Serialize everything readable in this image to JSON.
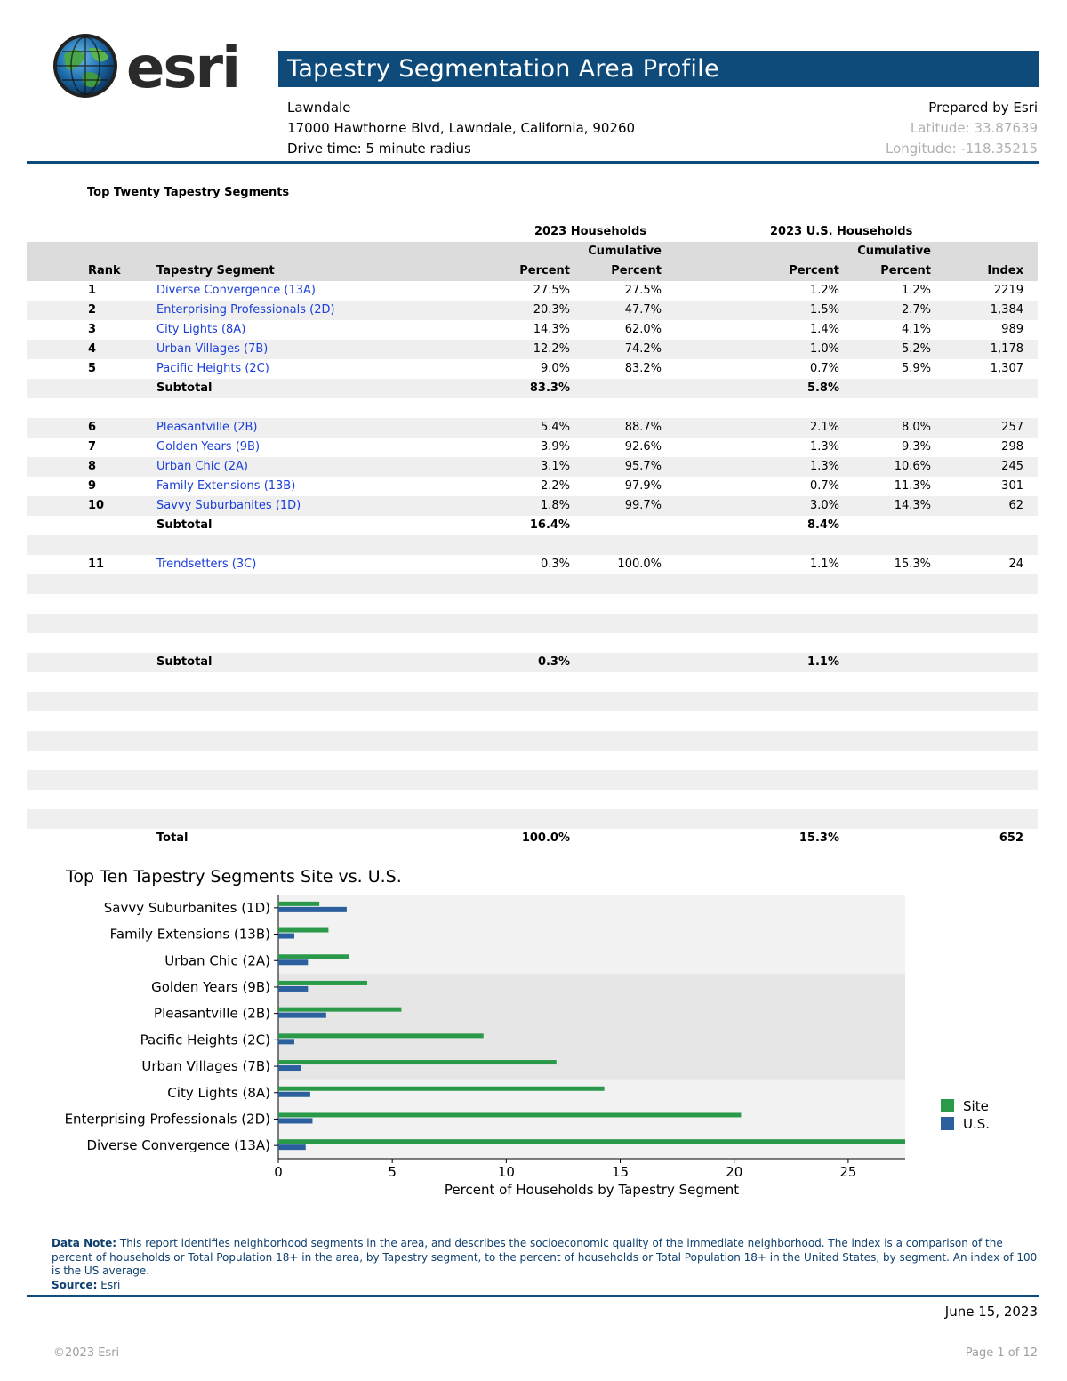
{
  "report": {
    "title": "Tapestry Segmentation Area Profile",
    "area_name": "Lawndale",
    "address": "17000 Hawthorne Blvd, Lawndale, California, 90260",
    "drive_time": "Drive time: 5 minute radius",
    "prepared_by": "Prepared by Esri",
    "latitude": "Latitude: 33.87639",
    "longitude": "Longitude: -118.35215",
    "logo_text": "esri"
  },
  "colors": {
    "brand_blue": "#0e4b7a",
    "link_blue": "#1a3ed9",
    "site_green": "#2a9a4a",
    "us_blue": "#2b5f9e"
  },
  "table": {
    "section_title": "Top Twenty Tapestry Segments",
    "group_headers": {
      "households": "2023 Households",
      "us_households": "2023 U.S. Households"
    },
    "headers": {
      "cumulative": "Cumulative",
      "rank": "Rank",
      "segment": "Tapestry Segment",
      "percent": "Percent",
      "cum_percent": "Percent",
      "us_percent": "Percent",
      "us_cum_percent": "Percent",
      "index": "Index"
    },
    "group1": [
      {
        "rank": "1",
        "segment": "Diverse Convergence (13A)",
        "pct": "27.5%",
        "cum": "27.5%",
        "us": "1.2%",
        "uscum": "1.2%",
        "idx": "2219"
      },
      {
        "rank": "2",
        "segment": "Enterprising Professionals (2D)",
        "pct": "20.3%",
        "cum": "47.7%",
        "us": "1.5%",
        "uscum": "2.7%",
        "idx": "1,384"
      },
      {
        "rank": "3",
        "segment": "City Lights (8A)",
        "pct": "14.3%",
        "cum": "62.0%",
        "us": "1.4%",
        "uscum": "4.1%",
        "idx": "989"
      },
      {
        "rank": "4",
        "segment": "Urban Villages (7B)",
        "pct": "12.2%",
        "cum": "74.2%",
        "us": "1.0%",
        "uscum": "5.2%",
        "idx": "1,178"
      },
      {
        "rank": "5",
        "segment": "Pacific Heights (2C)",
        "pct": "9.0%",
        "cum": "83.2%",
        "us": "0.7%",
        "uscum": "5.9%",
        "idx": "1,307"
      }
    ],
    "subtotal1": {
      "label": "Subtotal",
      "pct": "83.3%",
      "us": "5.8%"
    },
    "group2": [
      {
        "rank": "6",
        "segment": "Pleasantville (2B)",
        "pct": "5.4%",
        "cum": "88.7%",
        "us": "2.1%",
        "uscum": "8.0%",
        "idx": "257"
      },
      {
        "rank": "7",
        "segment": "Golden Years (9B)",
        "pct": "3.9%",
        "cum": "92.6%",
        "us": "1.3%",
        "uscum": "9.3%",
        "idx": "298"
      },
      {
        "rank": "8",
        "segment": "Urban Chic (2A)",
        "pct": "3.1%",
        "cum": "95.7%",
        "us": "1.3%",
        "uscum": "10.6%",
        "idx": "245"
      },
      {
        "rank": "9",
        "segment": "Family Extensions (13B)",
        "pct": "2.2%",
        "cum": "97.9%",
        "us": "0.7%",
        "uscum": "11.3%",
        "idx": "301"
      },
      {
        "rank": "10",
        "segment": "Savvy Suburbanites (1D)",
        "pct": "1.8%",
        "cum": "99.7%",
        "us": "3.0%",
        "uscum": "14.3%",
        "idx": "62"
      }
    ],
    "subtotal2": {
      "label": "Subtotal",
      "pct": "16.4%",
      "us": "8.4%"
    },
    "group3": [
      {
        "rank": "11",
        "segment": "Trendsetters (3C)",
        "pct": "0.3%",
        "cum": "100.0%",
        "us": "1.1%",
        "uscum": "15.3%",
        "idx": "24"
      }
    ],
    "subtotal3": {
      "label": "Subtotal",
      "pct": "0.3%",
      "us": "1.1%"
    },
    "total": {
      "label": "Total",
      "pct": "100.0%",
      "us": "15.3%",
      "idx": "652"
    }
  },
  "chart_data": {
    "type": "bar",
    "orientation": "horizontal",
    "title": "Top Ten Tapestry Segments Site vs. U.S.",
    "xlabel": "Percent of Households by Tapestry Segment",
    "ylabel": "",
    "xlim": [
      0,
      27.5
    ],
    "xticks": [
      0,
      5,
      10,
      15,
      20,
      25
    ],
    "categories": [
      "Diverse Convergence (13A)",
      "Enterprising Professionals (2D)",
      "City Lights (8A)",
      "Urban Villages (7B)",
      "Pacific Heights (2C)",
      "Pleasantville (2B)",
      "Golden Years (9B)",
      "Urban Chic (2A)",
      "Family Extensions (13B)",
      "Savvy Suburbanites (1D)"
    ],
    "series": [
      {
        "name": "Site",
        "color": "#2a9a4a",
        "values": [
          27.5,
          20.3,
          14.3,
          12.2,
          9.0,
          5.4,
          3.9,
          3.1,
          2.2,
          1.8
        ]
      },
      {
        "name": "U.S.",
        "color": "#2b5f9e",
        "values": [
          1.2,
          1.5,
          1.4,
          1.0,
          0.7,
          2.1,
          1.3,
          1.3,
          0.7,
          3.0
        ]
      }
    ],
    "legend_position": "right"
  },
  "footer": {
    "note_label": "Data Note:",
    "note_text": "This report identifies neighborhood segments in the area, and describes the socioeconomic quality of the immediate neighborhood.  The index is a comparison of the percent of households or Total Population 18+ in the area, by Tapestry segment, to the percent of households or Total Population 18+ in the United States, by segment.  An index of 100 is the US average.",
    "source_label": "Source:",
    "source_text": "Esri",
    "date": "June 15, 2023",
    "copyright": "©2023 Esri",
    "page": "Page 1 of 12"
  }
}
